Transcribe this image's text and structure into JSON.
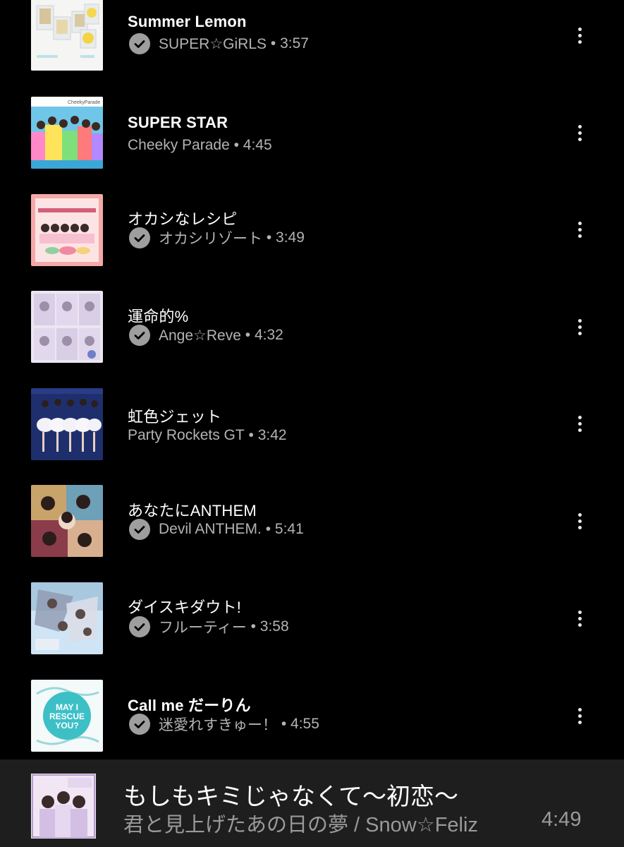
{
  "tracks": [
    {
      "title": "Summer Lemon",
      "artist": "SUPER☆GiRLS",
      "duration": "3:57",
      "downloaded": true,
      "title_bold": true
    },
    {
      "title": "SUPER STAR",
      "artist": "Cheeky Parade",
      "duration": "4:45",
      "downloaded": false,
      "title_bold": true
    },
    {
      "title": "オカシなレシピ",
      "artist": "オカシリゾート",
      "duration": "3:49",
      "downloaded": true,
      "title_bold": false
    },
    {
      "title": "運命的%",
      "artist": "Ange☆Reve",
      "duration": "4:32",
      "downloaded": true,
      "title_bold": false
    },
    {
      "title": "虹色ジェット",
      "artist": "Party Rockets GT",
      "duration": "3:42",
      "downloaded": false,
      "title_bold": false
    },
    {
      "title": "あなたにANTHEM",
      "artist": "Devil ANTHEM.",
      "duration": "5:41",
      "downloaded": true,
      "title_bold": false
    },
    {
      "title": "ダイスキダウト!",
      "artist": "フルーティー",
      "duration": "3:58",
      "downloaded": true,
      "title_bold": false
    },
    {
      "title": "Call me だーりん",
      "artist": "迷愛れすきゅー！",
      "duration": "4:55",
      "downloaded": true,
      "title_bold": false
    }
  ],
  "now_playing": {
    "title": "もしもキミじゃなくて〜初恋〜",
    "subtitle": "君と見上げたあの日の夢 / Snow☆Feliz",
    "time": "4:49"
  },
  "thumb_texts": {
    "cheeky": "CheekyParade",
    "call_me_1": "MAY I",
    "call_me_2": "RESCUE",
    "call_me_3": "YOU?"
  },
  "icons": {
    "downloaded": "check-circle-icon",
    "more": "more-vertical-icon"
  },
  "colors": {
    "background": "#000000",
    "text_secondary": "#b3b3b3",
    "player_bg": "#1e1e1e"
  }
}
